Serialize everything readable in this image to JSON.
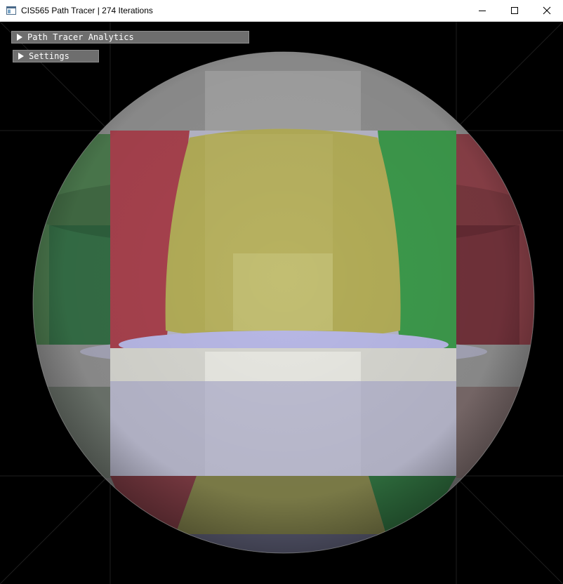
{
  "window": {
    "title": "CIS565 Path Tracer | 274 Iterations",
    "icon": "app-window-icon",
    "controls": [
      "minimize-icon",
      "maximize-icon",
      "close-icon"
    ]
  },
  "gui": {
    "panels": [
      {
        "label": "Path Tracer Analytics",
        "collapsed": true,
        "icon": "triangle-right-icon"
      },
      {
        "label": "Settings",
        "collapsed": true,
        "icon": "triangle-right-icon"
      }
    ]
  },
  "render": {
    "scene": "cornell-box",
    "colors": {
      "red_wall": "#b03c4c",
      "green_wall": "#3a9a4a",
      "back_wall": "#b9b45a",
      "floor": "#c8c8d8",
      "ceiling": "#8c8c8c",
      "background": "#000000",
      "sphere": "#a8a8a8"
    }
  }
}
